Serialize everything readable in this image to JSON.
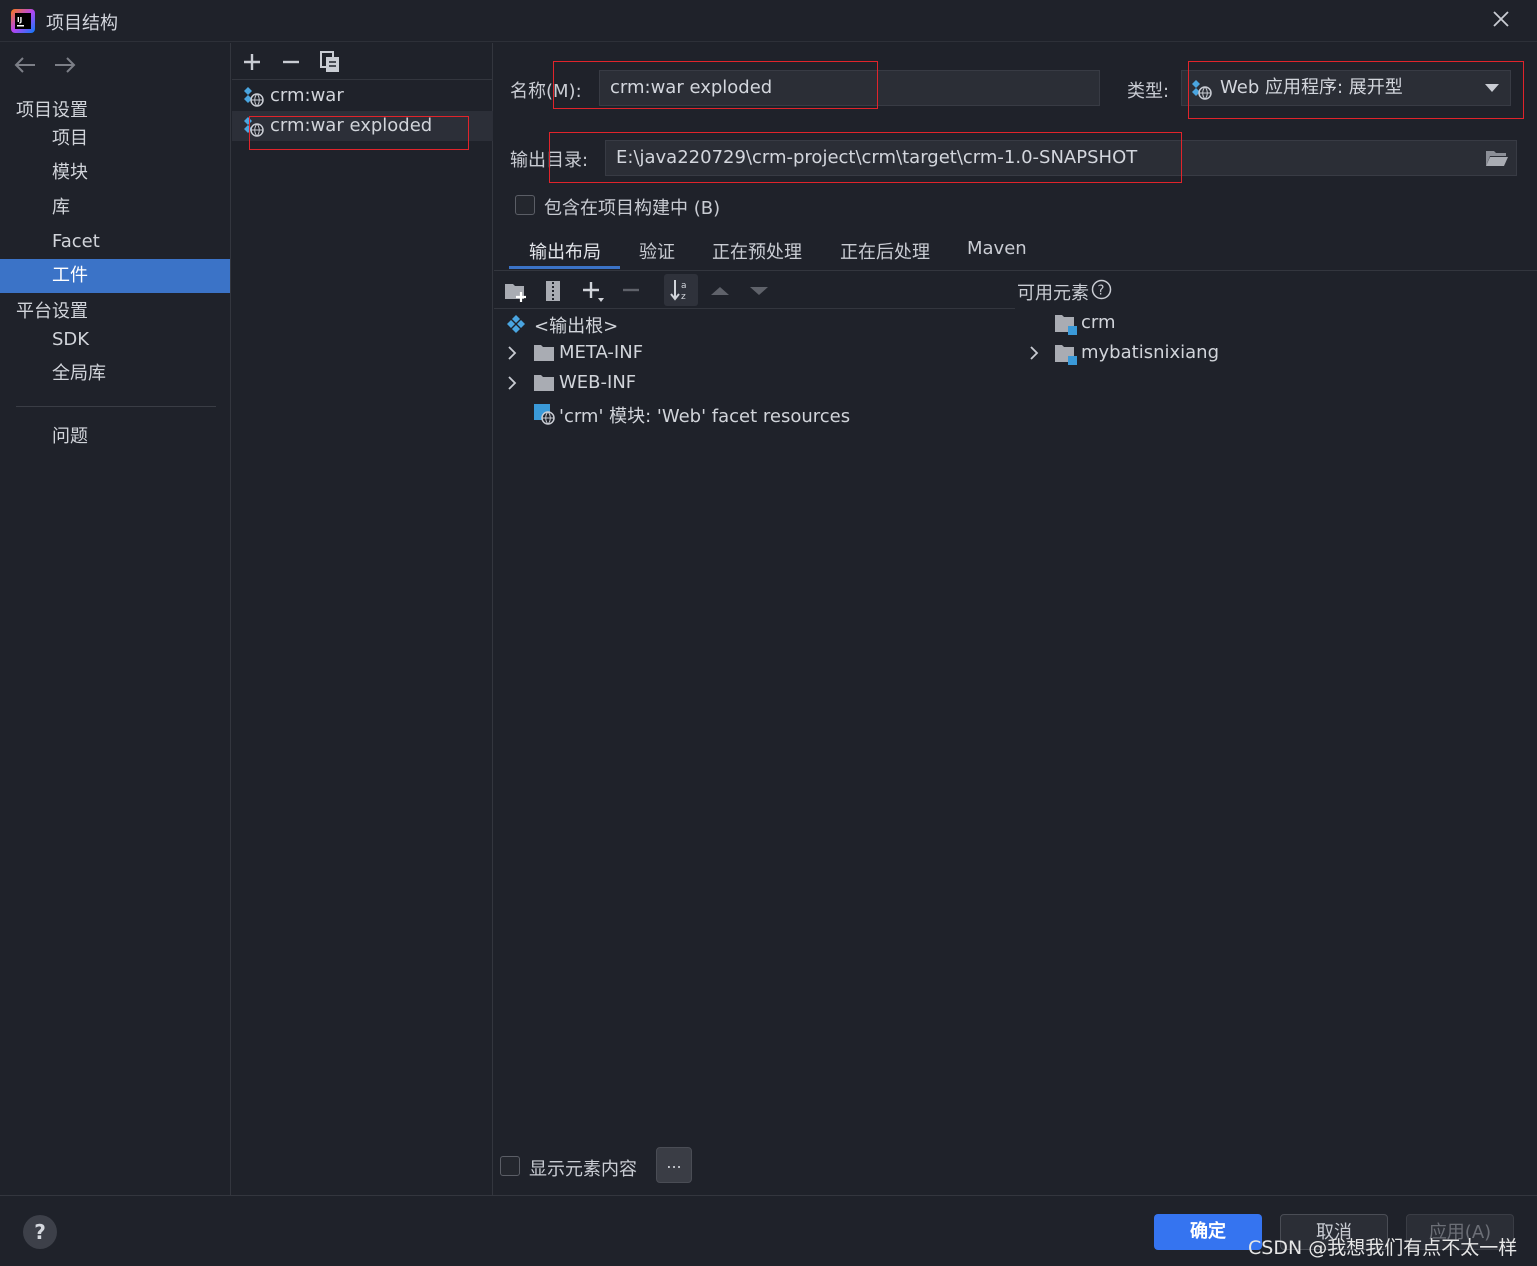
{
  "window": {
    "title": "项目结构"
  },
  "nav": {
    "back_label": "←",
    "forward_label": "→",
    "project_settings": "项目设置",
    "items_project": [
      "项目",
      "模块",
      "库",
      "Facet",
      "工件"
    ],
    "platform_settings": "平台设置",
    "items_platform": [
      "SDK",
      "全局库"
    ],
    "problems": "问题",
    "selected": "工件"
  },
  "artifacts": {
    "list": [
      "crm:war",
      "crm:war exploded"
    ],
    "selected": "crm:war exploded"
  },
  "form": {
    "name_label": "名称(M):",
    "name_value": "crm:war exploded",
    "type_label": "类型:",
    "type_value": "Web 应用程序: 展开型",
    "output_label": "输出目录:",
    "output_value": "E:\\java220729\\crm-project\\crm\\target\\crm-1.0-SNAPSHOT",
    "include_build_label": "包含在项目构建中 (B)"
  },
  "tabs": [
    "输出布局",
    "验证",
    "正在预处理",
    "正在后处理",
    "Maven"
  ],
  "active_tab": "输出布局",
  "layout_tree": {
    "root": "<输出根>",
    "items": [
      "META-INF",
      "WEB-INF",
      "'crm' 模块: 'Web' facet resources"
    ]
  },
  "available": {
    "label": "可用元素",
    "items": [
      "crm",
      "mybatisnixiang"
    ]
  },
  "show_content_label": "显示元素内容",
  "more_label": "...",
  "buttons": {
    "ok": "确定",
    "cancel": "取消",
    "apply": "应用(A)",
    "help": "?"
  },
  "watermark": "CSDN @我想我们有点不太一样",
  "colors": {
    "accent": "#3b73c7",
    "ok_button": "#3574f0",
    "highlight_box": "#e0242b"
  }
}
